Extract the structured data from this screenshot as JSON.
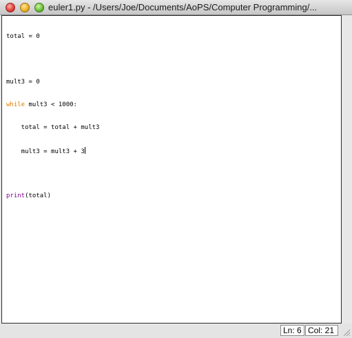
{
  "window": {
    "title": "euler1.py - /Users/Joe/Documents/AoPS/Computer Programming/...",
    "controls": {
      "close": "close-button",
      "minimize": "minimize-button",
      "zoom": "zoom-button"
    }
  },
  "editor": {
    "lines": [
      {
        "text": "total = 0"
      },
      {
        "text": ""
      },
      {
        "text": "mult3 = 0"
      },
      {
        "keyword": "while",
        "rest": " mult3 < 1000:"
      },
      {
        "text": "    total = total + mult3"
      },
      {
        "text": "    mult3 = mult3 + 3"
      },
      {
        "text": ""
      },
      {
        "builtin": "print",
        "rest": "(total)"
      }
    ]
  },
  "status": {
    "line": "Ln: 6",
    "column": "Col: 21"
  },
  "colors": {
    "keyword": "#e07f00",
    "builtin": "#8a009a"
  }
}
